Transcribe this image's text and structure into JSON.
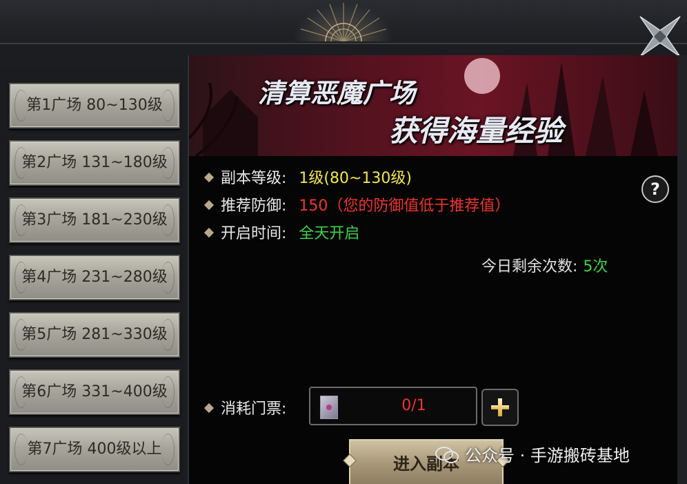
{
  "levels": [
    {
      "label": "第1广场 80~130级"
    },
    {
      "label": "第2广场 131~180级"
    },
    {
      "label": "第3广场 181~230级"
    },
    {
      "label": "第4广场 231~280级"
    },
    {
      "label": "第5广场 281~330级"
    },
    {
      "label": "第6广场 331~400级"
    },
    {
      "label": "第7广场 400级以上"
    }
  ],
  "banner": {
    "line1": "清算恶魔广场",
    "line2": "获得海量经验"
  },
  "info": {
    "level_label": "副本等级:",
    "level_value": "1级(80~130级)",
    "defense_label": "推荐防御:",
    "defense_value": "150（您的防御值低于推荐值）",
    "time_label": "开启时间:",
    "time_value": "全天开启"
  },
  "help": {
    "symbol": "?"
  },
  "remaining": {
    "label": "今日剩余次数:",
    "value": "5次"
  },
  "ticket": {
    "label": "消耗门票:",
    "count": "0/1"
  },
  "enter": {
    "label": "进入副本"
  },
  "watermark": {
    "text": "公众号 · 手游搬砖基地"
  },
  "colors": {
    "yellow": "#f2e84b",
    "red": "#f2332e",
    "green": "#3ed34a"
  }
}
